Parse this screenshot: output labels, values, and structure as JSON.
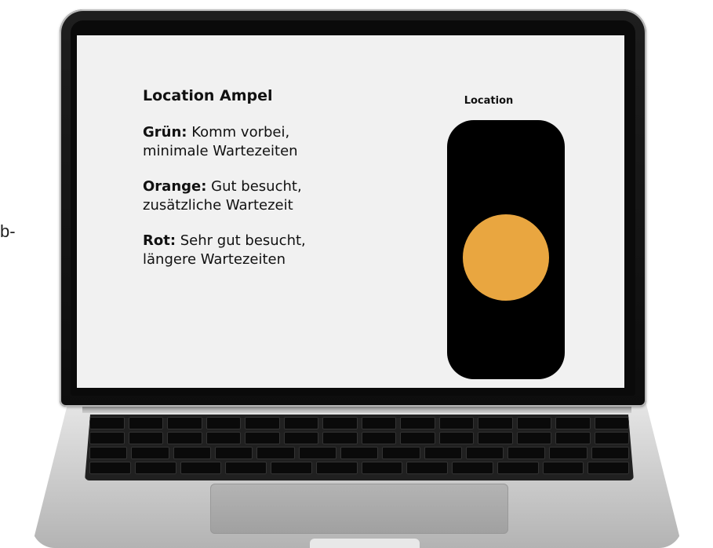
{
  "stray_text": "b-",
  "screen": {
    "legend": {
      "title": "Location Ampel",
      "items": [
        {
          "label": "Grün:",
          "text_line1": " Komm vorbei,",
          "text_line2": "minimale Wartezeiten"
        },
        {
          "label": "Orange:",
          "text_line1": " Gut besucht,",
          "text_line2": "zusätzliche Wartezeit"
        },
        {
          "label": "Rot:",
          "text_line1": " Sehr gut besucht,",
          "text_line2": "längere Wartezeiten"
        }
      ]
    },
    "traffic_light": {
      "label": "Location",
      "active_state": "orange",
      "lamp_color": "#e9a640"
    }
  }
}
